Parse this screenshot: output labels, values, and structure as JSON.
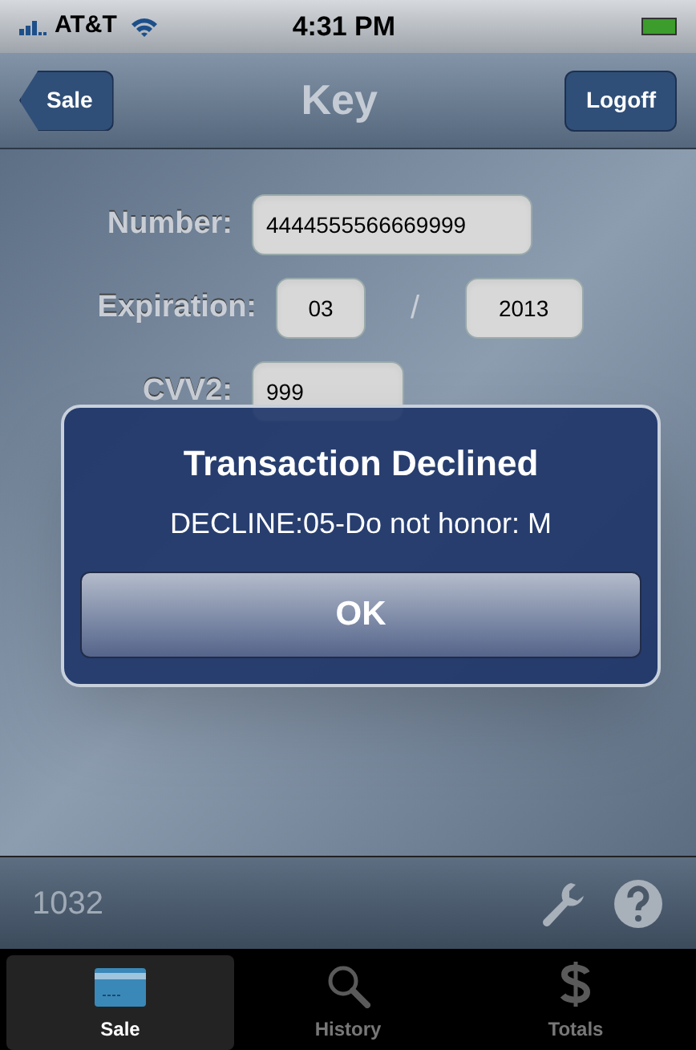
{
  "status_bar": {
    "carrier": "AT&T",
    "time": "4:31 PM"
  },
  "nav_bar": {
    "back_button": "Sale",
    "title": "Key",
    "right_button": "Logoff"
  },
  "form": {
    "number": {
      "label": "Number:",
      "value": "4444555566669999"
    },
    "expiration": {
      "label": "Expiration:",
      "month": "03",
      "separator": "/",
      "year": "2013"
    },
    "cvv2": {
      "label": "CVV2:",
      "value": "999"
    }
  },
  "alert": {
    "title": "Transaction Declined",
    "message": "DECLINE:05-Do not honor: M",
    "button": "OK"
  },
  "footer": {
    "id": "1032"
  },
  "tab_bar": [
    {
      "label": "Sale",
      "kind": "card",
      "selected": true
    },
    {
      "label": "History",
      "kind": "search",
      "selected": false
    },
    {
      "label": "Totals",
      "kind": "dollar",
      "selected": false
    }
  ]
}
